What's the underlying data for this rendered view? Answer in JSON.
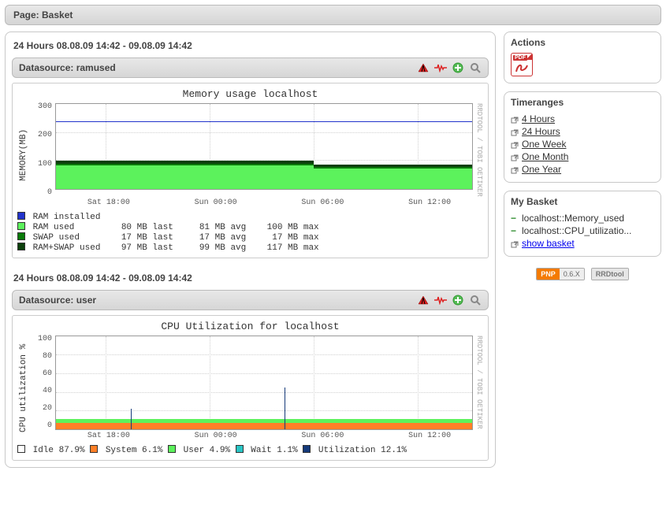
{
  "page_header": "Page: Basket",
  "main": {
    "graphs": [
      {
        "time_title": "24 Hours 08.08.09 14:42 - 09.08.09 14:42",
        "ds_label": "Datasource: ramused",
        "chart_title": "Memory usage localhost",
        "ylabel": "MEMORY(MB)",
        "watermark": "RRDTOOL / TOBI OETIKER",
        "yticks": [
          "300",
          "200",
          "100",
          "0"
        ],
        "xticks": [
          "Sat 18:00",
          "Sun 00:00",
          "Sun 06:00",
          "Sun 12:00"
        ],
        "legend_rows": [
          {
            "color": "#2233cc",
            "text": "RAM installed"
          },
          {
            "color": "#5cf25c",
            "text": "RAM used         80 MB last     81 MB avg    100 MB max"
          },
          {
            "color": "#0a7a0a",
            "text": "SWAP used        17 MB last     17 MB avg     17 MB max"
          },
          {
            "color": "#0b3f0b",
            "text": "RAM+SWAP used    97 MB last     99 MB avg    117 MB max"
          }
        ]
      },
      {
        "time_title": "24 Hours 08.08.09 14:42 - 09.08.09 14:42",
        "ds_label": "Datasource: user",
        "chart_title": "CPU Utilization for localhost",
        "ylabel": "CPU utilization %",
        "watermark": "RRDTOOL / TOBI OETIKER",
        "yticks": [
          "100",
          "80",
          "60",
          "40",
          "20",
          "0"
        ],
        "xticks": [
          "Sat 18:00",
          "Sun 00:00",
          "Sun 06:00",
          "Sun 12:00"
        ],
        "legend_line": {
          "parts": [
            {
              "color": "#ffffff",
              "stroke": "#333",
              "label": "Idle",
              "val": "87.9%"
            },
            {
              "color": "#ff7f27",
              "label": "System",
              "val": "6.1%"
            },
            {
              "color": "#5cf25c",
              "label": "User",
              "val": "4.9%"
            },
            {
              "color": "#29c5c5",
              "label": "Wait",
              "val": "1.1%"
            },
            {
              "color": "#153a7a",
              "label": "Utilization",
              "val": "12.1%"
            }
          ]
        }
      }
    ]
  },
  "sidebar": {
    "actions_title": "Actions",
    "timeranges_title": "Timeranges",
    "timeranges": [
      "4 Hours",
      "24 Hours",
      "One Week",
      "One Month",
      "One Year"
    ],
    "basket_title": "My Basket",
    "basket_items": [
      "localhost::Memory_used",
      "localhost::CPU_utilizatio..."
    ],
    "show_basket": "show basket",
    "pnp_badge_l": "PNP",
    "pnp_badge_r": "0.6.X",
    "rrd_badge": "RRDtool"
  },
  "chart_data": [
    {
      "type": "area",
      "title": "Memory usage localhost",
      "ylabel": "MEMORY(MB)",
      "xlabel": "",
      "ylim": [
        0,
        320
      ],
      "x_categories": [
        "Sat 18:00",
        "Sun 00:00",
        "Sun 06:00",
        "Sun 12:00"
      ],
      "series": [
        {
          "name": "RAM installed",
          "role": "line",
          "value_constant": 256
        },
        {
          "name": "RAM used",
          "role": "area",
          "last": 80,
          "avg": 81,
          "max": 100,
          "approx_timeline": [
            100,
            95,
            95,
            92,
            90,
            90,
            80,
            80,
            80,
            80
          ]
        },
        {
          "name": "SWAP used",
          "role": "area",
          "last": 17,
          "avg": 17,
          "max": 17,
          "approx_timeline": [
            17,
            17,
            17,
            17,
            17,
            17,
            17,
            17,
            17,
            17
          ]
        },
        {
          "name": "RAM+SWAP used",
          "role": "area",
          "last": 97,
          "avg": 99,
          "max": 117,
          "approx_timeline": [
            117,
            112,
            112,
            109,
            107,
            107,
            97,
            97,
            97,
            97
          ]
        }
      ]
    },
    {
      "type": "area",
      "title": "CPU Utilization for localhost",
      "ylabel": "CPU utilization %",
      "xlabel": "",
      "ylim": [
        0,
        100
      ],
      "x_categories": [
        "Sat 18:00",
        "Sun 00:00",
        "Sun 06:00",
        "Sun 12:00"
      ],
      "series": [
        {
          "name": "Idle",
          "value": 87.9
        },
        {
          "name": "System",
          "value": 6.1
        },
        {
          "name": "User",
          "value": 4.9
        },
        {
          "name": "Wait",
          "value": 1.1
        },
        {
          "name": "Utilization",
          "value": 12.1,
          "spikes_pct_x": [
            18,
            55
          ]
        }
      ]
    }
  ]
}
